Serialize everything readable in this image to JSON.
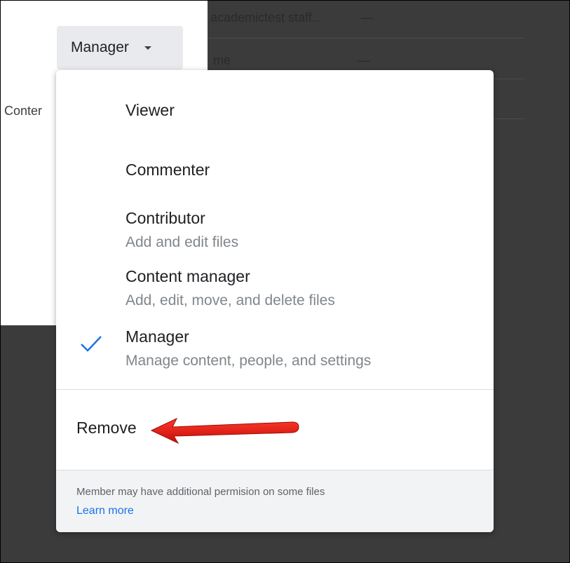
{
  "background": {
    "table_rows": [
      {
        "name": "academictest staff..",
        "value": "—"
      },
      {
        "name": "me",
        "value": "—"
      }
    ],
    "cut_label": "Conter"
  },
  "role_button": {
    "label": "Manager",
    "icon": "caret-down-icon"
  },
  "menu": {
    "items": [
      {
        "label": "Viewer",
        "description": ""
      },
      {
        "label": "Commenter",
        "description": ""
      },
      {
        "label": "Contributor",
        "description": "Add and edit files"
      },
      {
        "label": "Content manager",
        "description": "Add, edit, move, and delete files"
      },
      {
        "label": "Manager",
        "description": "Manage content, people, and settings",
        "selected": true
      }
    ],
    "check_icon": "check-icon",
    "check_color": "#1a73e8",
    "remove_label": "Remove",
    "footer_note": "Member may have additional permision on some files",
    "learn_more": "Learn more"
  },
  "annotation": {
    "arrow_color": "#e8130c",
    "icon": "red-arrow-icon"
  }
}
